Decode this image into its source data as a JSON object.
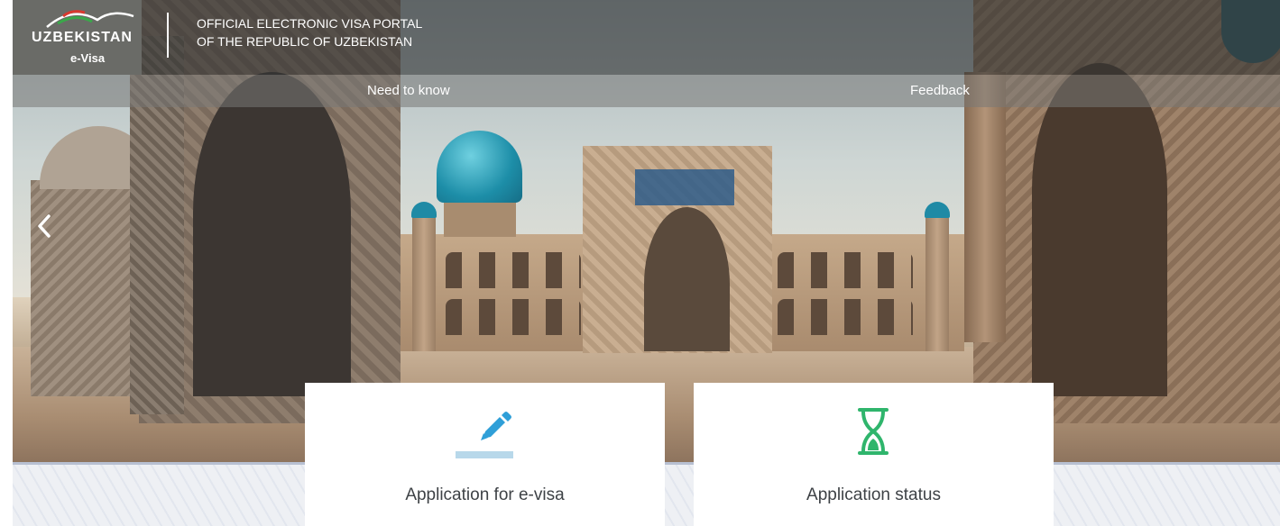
{
  "brand": {
    "logo_word": "UZBEKISTAN",
    "logo_sub": "e-Visa",
    "portal_title_line1": "OFFICIAL ELECTRONIC VISA PORTAL",
    "portal_title_line2": "OF THE REPUBLIC OF UZBEKISTAN"
  },
  "nav": {
    "need_to_know": "Need to know",
    "feedback": "Feedback"
  },
  "carousel": {
    "prev_icon": "chevron-left-icon"
  },
  "cards": [
    {
      "label": "Application for e-visa",
      "icon": "pencil-icon",
      "icon_color": "#2f9fd8",
      "underline_color": "#b8d8ea"
    },
    {
      "label": "Application status",
      "icon": "hourglass-icon",
      "icon_color": "#2fb56c"
    }
  ],
  "colors": {
    "header_overlay": "#323434",
    "nav_overlay": "#787876",
    "card_bg": "#ffffff",
    "text_dark": "#3e4246"
  }
}
